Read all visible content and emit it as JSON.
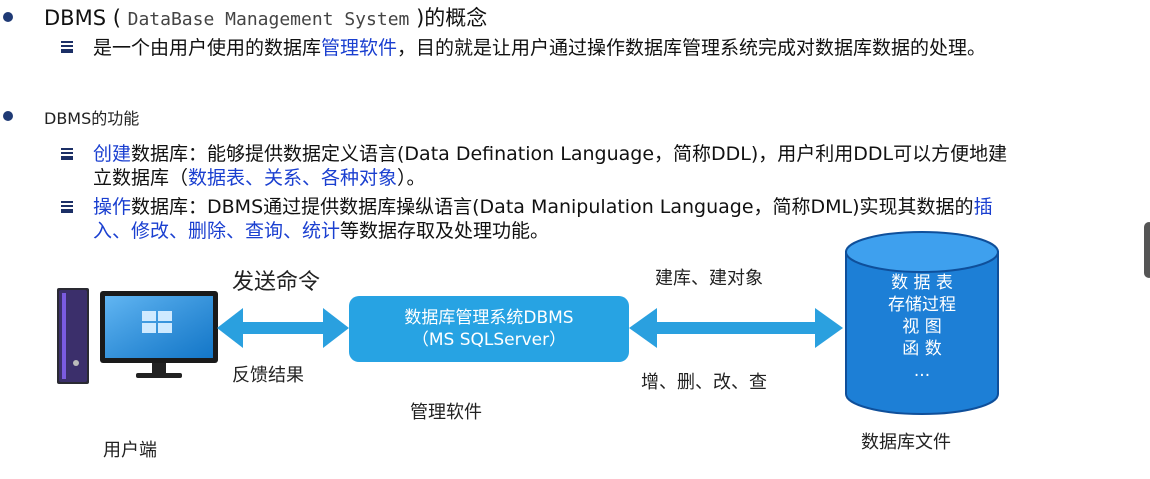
{
  "concept": {
    "title_prefix": "DBMS",
    "title_paren_open": "(",
    "title_name": "DataBase Management System",
    "title_suffix": ")的概念",
    "desc_part1": "是一个由用户使用的数据库",
    "desc_link": "管理软件",
    "desc_part2": "，目的就是让用户通过操作数据库管理系统完成对数据库数据的处理。"
  },
  "functions": {
    "heading": "DBMS的功能",
    "item1": {
      "link": "创建",
      "text_a": "数据库：能够提供数据定义语言(Data Defination Language，简称DDL)，用户利用DDL可以方便地建",
      "text_b": "立数据库（",
      "link2": "数据表、关系、各种对象",
      "text_c": "）。"
    },
    "item2": {
      "link": "操作",
      "text_a": "数据库：DBMS通过提供数据库操纵语言(Data Manipulation Language，简称DML)实现其数据的",
      "link2_a": "插",
      "link2_b": "入、修改、删除、查询、统计",
      "text_c": "等数据存取及处理功能。"
    }
  },
  "diagram": {
    "send_command": "发送命令",
    "feedback": "反馈结果",
    "client_label": "用户端",
    "dbms_line1": "数据库管理系统DBMS",
    "dbms_line2": "（MS SQLServer）",
    "mgmt_software": "管理软件",
    "create_label": "建库、建对象",
    "crud_label": "增、删、改、查",
    "db_items": [
      "数 据 表",
      "存储过程",
      "视  图",
      "函  数",
      "..."
    ],
    "db_file_label": "数据库文件",
    "colors": {
      "arrow": "#2aa0df",
      "box": "#27a3e3",
      "cylinder": "#1d7fd6",
      "link": "#1a3fd0"
    }
  }
}
